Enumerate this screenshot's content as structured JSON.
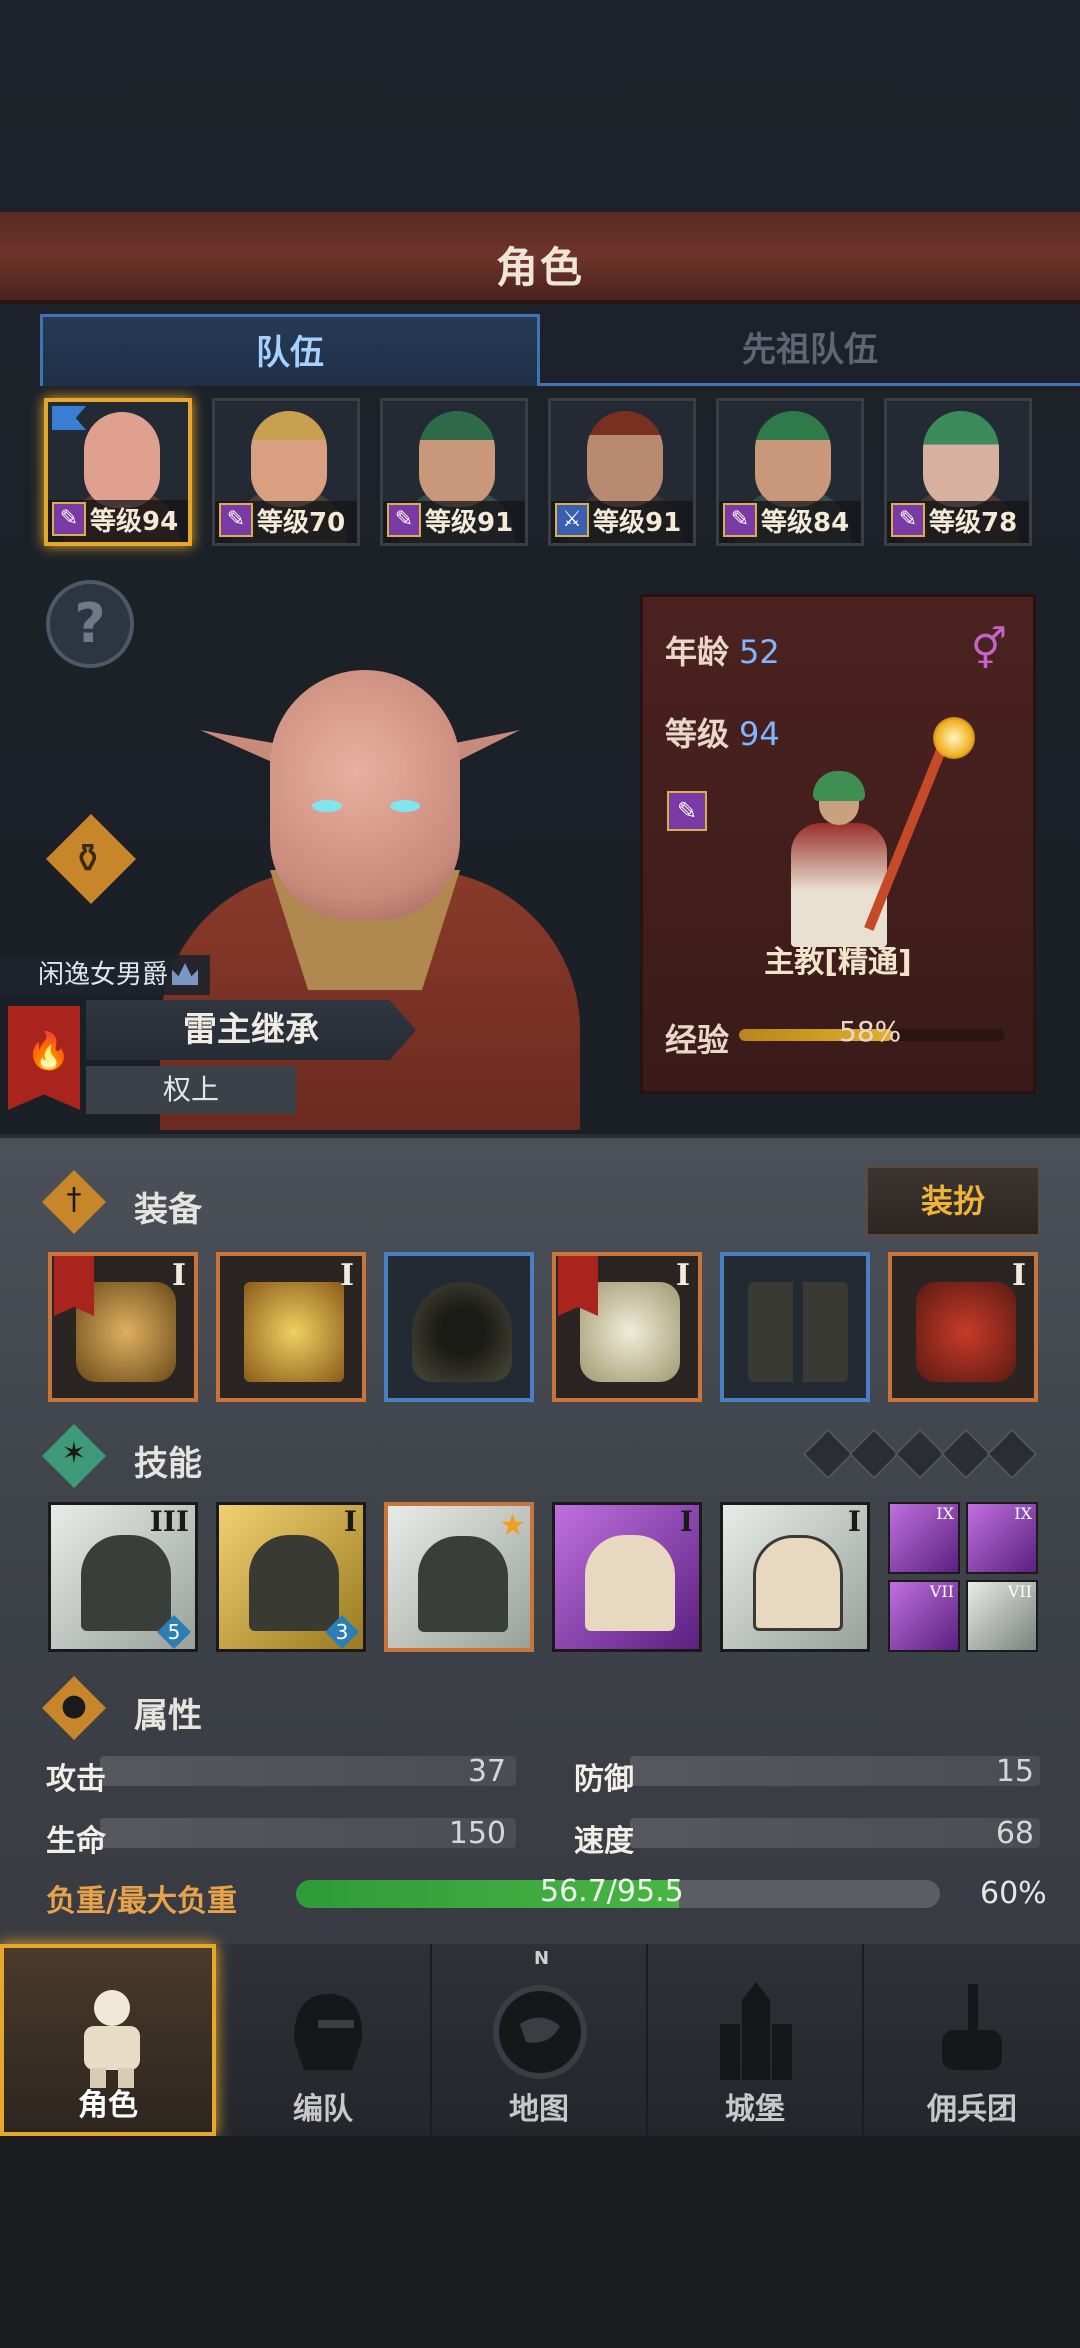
{
  "header": {
    "title": "角色"
  },
  "tabs": {
    "team": "队伍",
    "ancestor_team": "先祖队伍"
  },
  "party": [
    {
      "level": "等级94",
      "selected": true
    },
    {
      "level": "等级70"
    },
    {
      "level": "等级91"
    },
    {
      "level": "等级91"
    },
    {
      "level": "等级84"
    },
    {
      "level": "等级78"
    }
  ],
  "help": {
    "label": "?"
  },
  "character": {
    "nobility": "闲逸女男爵",
    "title_main": "雷主继承",
    "title_sub": "权上"
  },
  "info": {
    "age_label": "年龄",
    "age_value": "52",
    "level_label": "等级",
    "level_value": "94",
    "gender_symbol": "⚥",
    "job_name": "主教[精通]",
    "exp_label": "经验",
    "exp_percent_text": "58%",
    "exp_fraction": 0.58
  },
  "equipment": {
    "title": "装备",
    "dress_button": "装扮",
    "slots": [
      {
        "rank": "I",
        "tier": "orange"
      },
      {
        "rank": "I",
        "tier": "orange"
      },
      {
        "rank": "",
        "tier": "blue"
      },
      {
        "rank": "I",
        "tier": "orange"
      },
      {
        "rank": "",
        "tier": "blue"
      },
      {
        "rank": "I",
        "tier": "orange"
      }
    ]
  },
  "skills": {
    "title": "技能",
    "items": [
      {
        "rank": "III",
        "badge": "5"
      },
      {
        "rank": "I",
        "badge": "3"
      },
      {
        "rank": "",
        "badge": ""
      },
      {
        "rank": "I",
        "badge": ""
      },
      {
        "rank": "I",
        "badge": ""
      }
    ],
    "mini": [
      "IX",
      "IX",
      "VII",
      "VII"
    ]
  },
  "attributes": {
    "title": "属性",
    "attack_label": "攻击",
    "attack_value": "37",
    "defense_label": "防御",
    "defense_value": "15",
    "hp_label": "生命",
    "hp_value": "150",
    "speed_label": "速度",
    "speed_value": "68",
    "load_label": "负重/最大负重",
    "load_text": "56.7/95.5",
    "load_percent": "60%",
    "load_fraction": 0.594
  },
  "nav": {
    "compass_n": "N",
    "items": [
      "角色",
      "编队",
      "地图",
      "城堡",
      "佣兵团"
    ]
  },
  "colors": {
    "accent": "#e7a72b",
    "tab_blue": "#3f73b5",
    "load_green": "#49b544"
  }
}
